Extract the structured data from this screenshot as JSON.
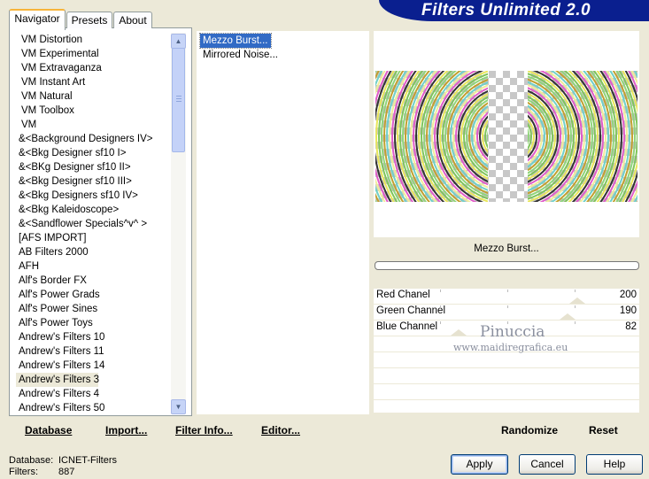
{
  "header": {
    "title": "Filters Unlimited 2.0"
  },
  "tabs": [
    {
      "label": "Navigator"
    },
    {
      "label": "Presets"
    },
    {
      "label": "About"
    }
  ],
  "categories": [
    "VM Distortion",
    "VM Experimental",
    "VM Extravaganza",
    "VM Instant Art",
    "VM Natural",
    "VM Toolbox",
    "VM",
    "&<Background Designers IV>",
    "&<Bkg Designer sf10 I>",
    "&<BKg Designer sf10 II>",
    "&<Bkg Designer sf10 III>",
    "&<Bkg Designers sf10 IV>",
    "&<Bkg Kaleidoscope>",
    "&<Sandflower Specials^v^ >",
    "[AFS IMPORT]",
    "AB Filters 2000",
    "AFH",
    "Alf's Border FX",
    "Alf's Power Grads",
    "Alf's Power Sines",
    "Alf's Power Toys",
    "Andrew's Filters 10",
    "Andrew's Filters 11",
    "Andrew's Filters 14",
    "Andrew's Filters 3",
    "Andrew's Filters 4",
    "Andrew's Filters 50"
  ],
  "selected_category": "Andrew's Filters 3",
  "filters": [
    "Mezzo Burst...",
    "Mirrored Noise..."
  ],
  "selected_filter": "Mezzo Burst...",
  "preview": {
    "filter_name": "Mezzo Burst..."
  },
  "parameters": [
    {
      "label": "Red Chanel",
      "value": "200",
      "level": 200
    },
    {
      "label": "Green Channel",
      "value": "190",
      "level": 190
    },
    {
      "label": "Blue Channel",
      "value": "82",
      "level": 82
    }
  ],
  "toolbar": {
    "database_label": "Database",
    "import_label": "Import...",
    "filter_info_label": "Filter Info...",
    "editor_label": "Editor...",
    "randomize_label": "Randomize",
    "reset_label": "Reset"
  },
  "status": {
    "database_label": "Database:",
    "database_value": "ICNET-Filters",
    "filters_label": "Filters:",
    "filters_value": "887"
  },
  "buttons": {
    "apply": "Apply",
    "cancel": "Cancel",
    "help": "Help"
  },
  "watermark": {
    "name": "Pinuccia",
    "url": "www.maidiregrafica.eu"
  },
  "colors": {
    "title_bar": "#0a1f8f",
    "selection": "#316ac5",
    "tab_accent": "#f7b43a"
  }
}
